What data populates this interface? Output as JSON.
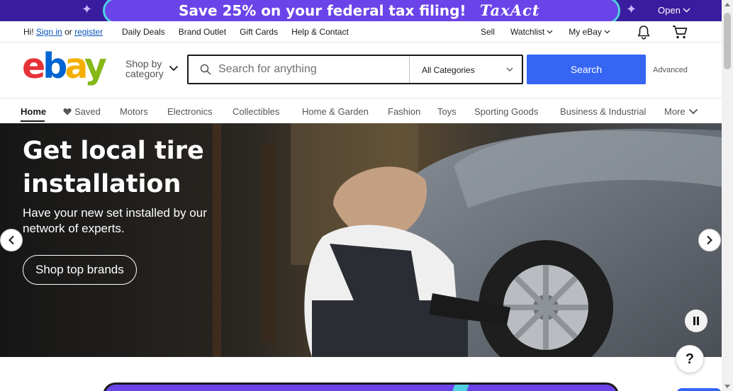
{
  "promo": {
    "headline": "Save 25% on your federal tax filing!",
    "brand": "TaxAct",
    "open_label": "Open",
    "colors": {
      "background": "#3a1d9e",
      "pill": "#6a44e8",
      "accent": "#4fd0e0"
    }
  },
  "topbar": {
    "greeting": "Hi!",
    "sign_in": "Sign in",
    "or": "or",
    "register": "register",
    "links": [
      "Daily Deals",
      "Brand Outlet",
      "Gift Cards",
      "Help & Contact"
    ],
    "sell": "Sell",
    "watchlist": "Watchlist",
    "my_ebay": "My eBay",
    "icons": [
      "bell-icon",
      "cart-icon"
    ]
  },
  "header": {
    "logo": {
      "e": "e",
      "b": "b",
      "a": "a",
      "y": "y"
    },
    "shop_by_category_line1": "Shop by",
    "shop_by_category_line2": "category",
    "search_placeholder": "Search for anything",
    "category_select": "All Categories",
    "search_button": "Search",
    "advanced": "Advanced",
    "colors": {
      "search_button": "#3665f3",
      "logo_e": "#e53238",
      "logo_b": "#0064d2",
      "logo_a": "#f5af02",
      "logo_y": "#86b817"
    }
  },
  "categories": {
    "home": "Home",
    "saved": "Saved",
    "items": [
      "Motors",
      "Electronics",
      "Collectibles",
      "Home & Garden",
      "Fashion",
      "Toys",
      "Sporting Goods",
      "Business & Industrial"
    ],
    "more": "More"
  },
  "hero": {
    "title": "Get local tire installation",
    "subtitle": "Have your new set installed by our network of experts.",
    "cta": "Shop top brands"
  },
  "help": {
    "label": "?"
  }
}
